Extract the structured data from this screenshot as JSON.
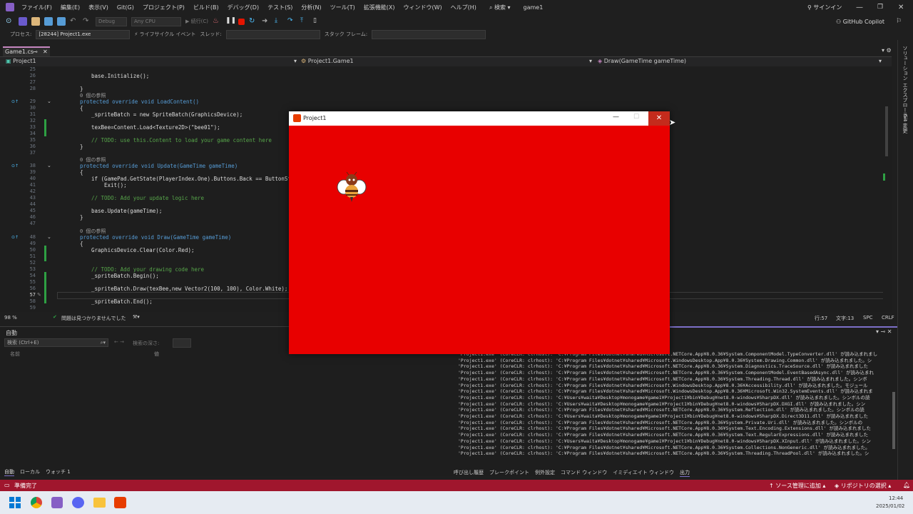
{
  "menu": [
    "ファイル(F)",
    "編集(E)",
    "表示(V)",
    "Git(G)",
    "プロジェクト(P)",
    "ビルド(B)",
    "デバッグ(D)",
    "テスト(S)",
    "分析(N)",
    "ツール(T)",
    "拡張機能(X)",
    "ウィンドウ(W)",
    "ヘルプ(H)"
  ],
  "search_label": "検索",
  "solution_name": "game1",
  "signin_label": "サインイン",
  "copilot_label": "GitHub Copilot",
  "toolbar": {
    "config": "Debug",
    "platform": "Any CPU",
    "run_label": "続行(C)"
  },
  "toolbar2": {
    "process_label": "プロセス:",
    "process_value": "[28244] Project1.exe",
    "lifecycle_label": "ライフサイクル イベント",
    "thread_label": "スレッド:",
    "stack_label": "スタック フレーム:"
  },
  "tab": {
    "file": "Game1.cs"
  },
  "nav": {
    "project": "Project1",
    "class": "Project1.Game1",
    "member": "Draw(GameTime gameTime)"
  },
  "code": {
    "line_numbers": [
      "25",
      "26",
      "27",
      "28",
      "",
      "29",
      "30",
      "31",
      "32",
      "33",
      "34",
      "35",
      "36",
      "37",
      "",
      "38",
      "39",
      "40",
      "41",
      "42",
      "43",
      "44",
      "45",
      "46",
      "47",
      "",
      "48",
      "49",
      "50",
      "51",
      "52",
      "53",
      "54",
      "55",
      "56",
      "57",
      "58",
      "59"
    ],
    "ref_count": "0 個の参照",
    "l26": "base.Initialize();",
    "l29": "protected override void LoadContent()",
    "l31": "_spriteBatch = new SpriteBatch(GraphicsDevice);",
    "l33": "texBee=Content.Load<Texture2D>(\"bee01\");",
    "l35": "// TODO: use this.Content to load your game content here",
    "l38": "protected override void Update(GameTime gameTime)",
    "l40": "if (GamePad.GetState(PlayerIndex.One).Buttons.Back == ButtonState",
    "l41": "Exit();",
    "l43": "// TODO: Add your update logic here",
    "l45": "base.Update(gameTime);",
    "l48": "protected override void Draw(GameTime gameTime)",
    "l50": "GraphicsDevice.Clear(Color.Red);",
    "l53": "// TODO: Add your drawing code here",
    "l54": "_spriteBatch.Begin();",
    "l56": "_spriteBatch.Draw(texBee,new Vector2(100, 100), Color.White);",
    "l58": "_spriteBatch.End();"
  },
  "edit_status": {
    "zoom": "98 %",
    "issues": "問題は見つかりませんでした",
    "line": "行:57",
    "col": "文字:13",
    "spc": "SPC",
    "crlf": "CRLF"
  },
  "auto_panel": {
    "title": "自動",
    "search_placeholder": "検索 (Ctrl+E)",
    "search_depth": "検索の深さ:",
    "col_name": "名前",
    "col_value": "値",
    "tabs": [
      "自動",
      "ローカル",
      "ウォッチ 1"
    ]
  },
  "output_lines": [
    "'Project1.exe' (CoreCLR: clrhost): 'C:¥Program Files¥dotnet¥shared¥Microsoft.NETCore.App¥8.0.36¥System.ComponentModel.TypeConverter.dll' が読み込まれまし",
    "'Project1.exe' (CoreCLR: clrhost): 'C:¥Program Files¥dotnet¥shared¥Microsoft.WindowsDesktop.App¥8.0.36¥System.Drawing.Common.dll' が読み込まれました。シ",
    "'Project1.exe' (CoreCLR: clrhost): 'C:¥Program Files¥dotnet¥shared¥Microsoft.NETCore.App¥8.0.36¥System.Diagnostics.TraceSource.dll' が読み込まれました",
    "'Project1.exe' (CoreCLR: clrhost): 'C:¥Program Files¥dotnet¥shared¥Microsoft.NETCore.App¥8.0.36¥System.ComponentModel.EventBasedAsync.dll' が読み込まれ",
    "'Project1.exe' (CoreCLR: clrhost): 'C:¥Program Files¥dotnet¥shared¥Microsoft.NETCore.App¥8.0.36¥System.Threading.Thread.dll' が読み込まれました。シンボ",
    "'Project1.exe' (CoreCLR: clrhost): 'C:¥Program Files¥dotnet¥shared¥Microsoft.WindowsDesktop.App¥8.0.36¥Accessibility.dll' が読み込まれました。モジュール",
    "'Project1.exe' (CoreCLR: clrhost): 'C:¥Program Files¥dotnet¥shared¥Microsoft.WindowsDesktop.App¥8.0.36¥Microsoft.Win32.SystemEvents.dll' が読み込まれま",
    "'Project1.exe' (CoreCLR: clrhost): 'C:¥Users¥waita¥Desktop¥monogame¥game1¥Project1¥bin¥Debug¥net8.0-windows¥SharpDX.dll' が読み込まれました。シンボルの読",
    "'Project1.exe' (CoreCLR: clrhost): 'C:¥Users¥waita¥Desktop¥monogame¥game1¥Project1¥bin¥Debug¥net8.0-windows¥SharpDX.DXGI.dll' が読み込まれました。シン",
    "'Project1.exe' (CoreCLR: clrhost): 'C:¥Program Files¥dotnet¥shared¥Microsoft.NETCore.App¥8.0.36¥System.Reflection.dll' が読み込まれました。シンボルの読",
    "'Project1.exe' (CoreCLR: clrhost): 'C:¥Users¥waita¥Desktop¥monogame¥game1¥Project1¥bin¥Debug¥net8.0-windows¥SharpDX.Direct3D11.dll' が読み込まれました",
    "'Project1.exe' (CoreCLR: clrhost): 'C:¥Program Files¥dotnet¥shared¥Microsoft.NETCore.App¥8.0.36¥System.Private.Uri.dll' が読み込まれました。シンボルの",
    "'Project1.exe' (CoreCLR: clrhost): 'C:¥Program Files¥dotnet¥shared¥Microsoft.NETCore.App¥8.0.36¥System.Text.Encoding.Extensions.dll' が読み込まれました",
    "'Project1.exe' (CoreCLR: clrhost): 'C:¥Program Files¥dotnet¥shared¥Microsoft.NETCore.App¥8.0.36¥System.Text.RegularExpressions.dll' が読み込まれました",
    "'Project1.exe' (CoreCLR: clrhost): 'C:¥Users¥waita¥Desktop¥monogame¥game1¥Project1¥bin¥Debug¥net8.0-windows¥SharpDX.XInput.dll' が読み込まれました。シン",
    "'Project1.exe' (CoreCLR: clrhost): 'C:¥Program Files¥dotnet¥shared¥Microsoft.NETCore.App¥8.0.36¥System.Collections.NonGeneric.dll' が読み込まれました。",
    "'Project1.exe' (CoreCLR: clrhost): 'C:¥Program Files¥dotnet¥shared¥Microsoft.NETCore.App¥8.0.36¥System.Threading.ThreadPool.dll' が読み込まれました。シ"
  ],
  "output_tabs": [
    "呼び出し履歴",
    "ブレークポイント",
    "例外設定",
    "コマンド ウィンドウ",
    "イミディエイト ウィンドウ",
    "出力"
  ],
  "status_bar": {
    "ready": "準備完了",
    "source_control": "ソース管理に追加",
    "repository": "リポジトリの選択"
  },
  "right_rail": {
    "solution_explorer": "ソリューション エクスプローラー",
    "git_changes": "Git 変更"
  },
  "game_window": {
    "title": "Project1"
  },
  "taskbar": {
    "time": "12:44",
    "date": "2025/01/02"
  },
  "colors": {
    "accent": "#7c6fc8",
    "status_bar": "#a0162d",
    "game_bg": "#e80000",
    "close_red": "#c42b1c"
  }
}
